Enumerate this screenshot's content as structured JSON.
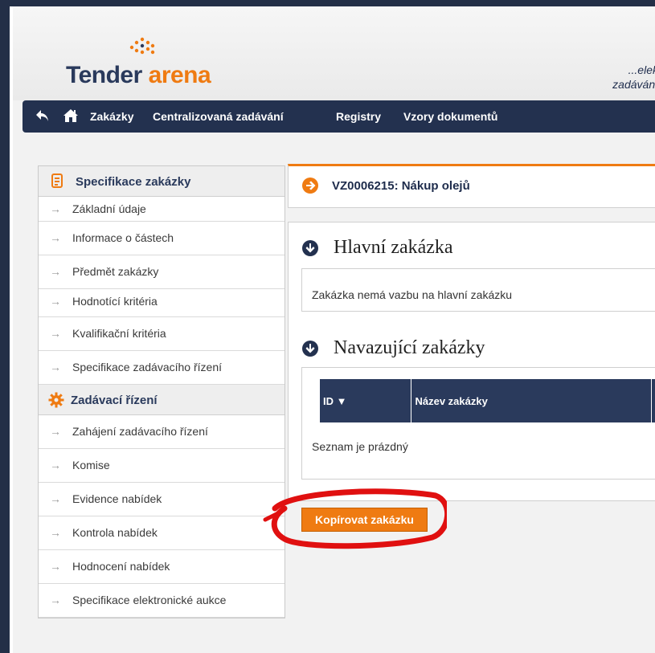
{
  "brand": {
    "name_part1": "Tender",
    "name_part2": "arena",
    "tagline_line1": "...elek",
    "tagline_line2": "zadávání",
    "accent": "#ef7b12",
    "navy": "#23314f"
  },
  "nav": {
    "back_icon": "back-arrow-icon",
    "home_icon": "home-icon",
    "items": [
      "Zakázky",
      "Centralizovaná zadávání",
      "Registry",
      "Vzory dokumentů"
    ]
  },
  "sidebar": {
    "section1": {
      "icon": "document-icon",
      "title": "Specifikace zakázky",
      "items": [
        "Základní údaje",
        "Informace o částech",
        "Předmět zakázky",
        "Hodnotící kritéria",
        "Kvalifikační kritéria",
        "Specifikace zadávacího řízení"
      ]
    },
    "section2": {
      "icon": "gear-icon",
      "title": "Zadávací řízení",
      "items": [
        "Zahájení zadávacího řízení",
        "Komise",
        "Evidence nabídek",
        "Kontrola nabídek",
        "Hodnocení nabídek",
        "Specifikace elektronické aukce"
      ]
    }
  },
  "main": {
    "contract_title": "VZ0006215: Nákup olejů",
    "main_contract": {
      "heading": "Hlavní zakázka",
      "message": "Zakázka nemá vazbu na hlavní zakázku"
    },
    "follow_up": {
      "heading": "Navazující zakázky",
      "columns": [
        "ID ▼",
        "Název zakázky"
      ],
      "empty_message": "Seznam je prázdný"
    },
    "copy_button": "Kopírovat zakázku"
  }
}
